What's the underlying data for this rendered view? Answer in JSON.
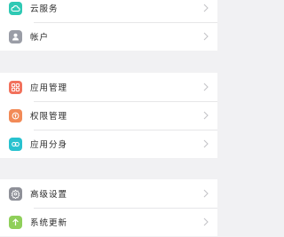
{
  "groups": [
    {
      "items": [
        {
          "label": "云服务",
          "icon": "cloud-icon",
          "color": "#2fc9b4"
        },
        {
          "label": "帐户",
          "icon": "person-icon",
          "color": "#9a9da6"
        }
      ]
    },
    {
      "items": [
        {
          "label": "应用管理",
          "icon": "grid-icon",
          "color": "#f2715c"
        },
        {
          "label": "权限管理",
          "icon": "key-icon",
          "color": "#f28a57"
        },
        {
          "label": "应用分身",
          "icon": "clone-icon",
          "color": "#28c2cf"
        }
      ]
    },
    {
      "items": [
        {
          "label": "高级设置",
          "icon": "gear-icon",
          "color": "#8e9098"
        },
        {
          "label": "系统更新",
          "icon": "arrow-up-icon",
          "color": "#8fcf5a"
        }
      ]
    }
  ],
  "colors": {
    "background": "#f1f1f3",
    "row_background": "#ffffff",
    "text": "#2a2a2a",
    "chevron": "#c4c4c8"
  }
}
